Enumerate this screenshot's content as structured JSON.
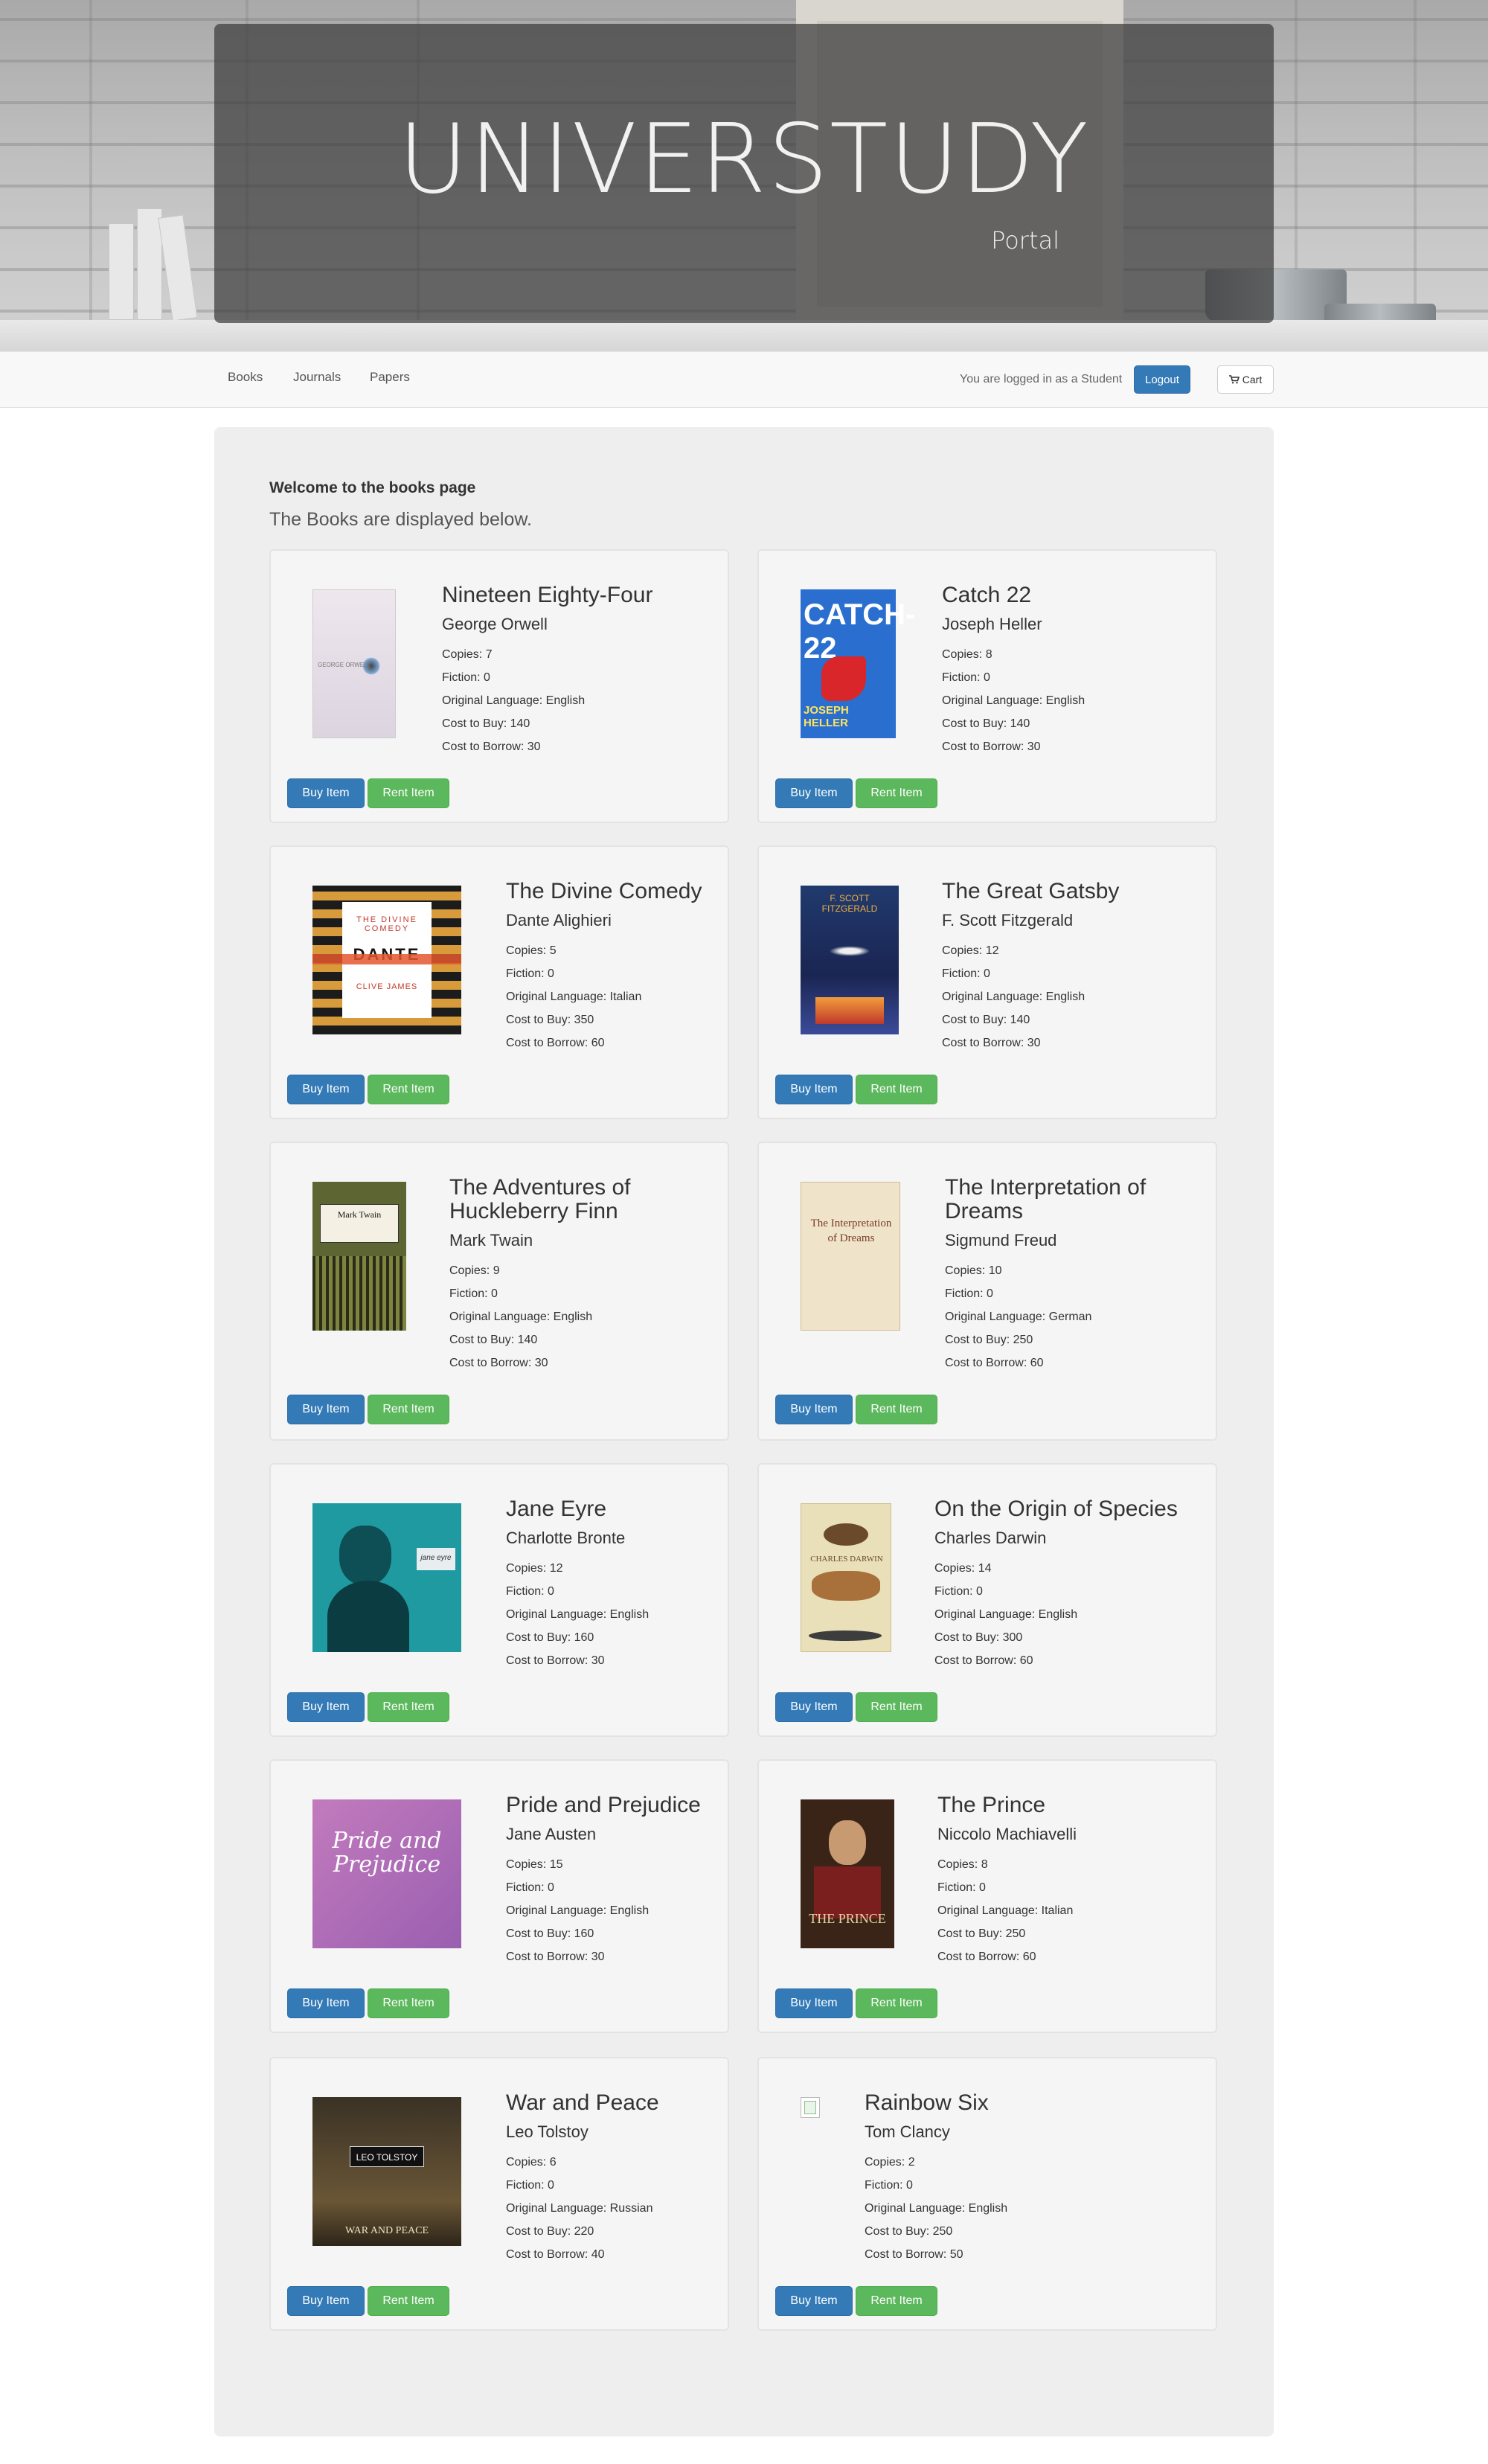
{
  "hero": {
    "title": "UNIVERSTUDY",
    "subtitle": "Portal"
  },
  "nav": {
    "links": [
      "Books",
      "Journals",
      "Papers"
    ],
    "login_text": "You are logged in as a Student",
    "logout_label": "Logout",
    "cart_label": "Cart"
  },
  "page": {
    "welcome": "Welcome to the books page",
    "subtitle": "The Books are displayed below."
  },
  "labels": {
    "buy": "Buy Item",
    "rent": "Rent Item"
  },
  "books": [
    {
      "title": "Nineteen Eighty-Four",
      "author": "George Orwell",
      "copies": "Copies: 7",
      "fiction": "Fiction: 0",
      "language": "Original Language: English",
      "buy": "Cost to Buy: 140",
      "borrow": "Cost to Borrow: 30",
      "cover_text": "GEORGE ORWELL"
    },
    {
      "title": "Catch 22",
      "author": "Joseph Heller",
      "copies": "Copies: 8",
      "fiction": "Fiction: 0",
      "language": "Original Language: English",
      "buy": "Cost to Buy: 140",
      "borrow": "Cost to Borrow: 30",
      "cover_text": "CATCH-22",
      "cover_text2": "JOSEPH HELLER"
    },
    {
      "title": "The Divine Comedy",
      "author": "Dante Alighieri",
      "copies": "Copies: 5",
      "fiction": "Fiction: 0",
      "language": "Original Language: Italian",
      "buy": "Cost to Buy: 350",
      "borrow": "Cost to Borrow: 60",
      "cover_text": "THE DIVINE COMEDY",
      "cover_text2": "DANTE",
      "cover_text3": "CLIVE JAMES"
    },
    {
      "title": "The Great Gatsby",
      "author": "F. Scott Fitzgerald",
      "copies": "Copies: 12",
      "fiction": "Fiction: 0",
      "language": "Original Language: English",
      "buy": "Cost to Buy: 140",
      "borrow": "Cost to Borrow: 30",
      "cover_text": "F. SCOTT FITZGERALD"
    },
    {
      "title": "The Adventures of Huckleberry Finn",
      "author": "Mark Twain",
      "copies": "Copies: 9",
      "fiction": "Fiction: 0",
      "language": "Original Language: English",
      "buy": "Cost to Buy: 140",
      "borrow": "Cost to Borrow: 30",
      "cover_text": "Mark Twain"
    },
    {
      "title": "The Interpretation of Dreams",
      "author": "Sigmund Freud",
      "copies": "Copies: 10",
      "fiction": "Fiction: 0",
      "language": "Original Language: German",
      "buy": "Cost to Buy: 250",
      "borrow": "Cost to Borrow: 60",
      "cover_text": "The Interpretation of Dreams"
    },
    {
      "title": "Jane Eyre",
      "author": "Charlotte Bronte",
      "copies": "Copies: 12",
      "fiction": "Fiction: 0",
      "language": "Original Language: English",
      "buy": "Cost to Buy: 160",
      "borrow": "Cost to Borrow: 30",
      "cover_text": "jane eyre"
    },
    {
      "title": "On the Origin of Species",
      "author": "Charles Darwin",
      "copies": "Copies: 14",
      "fiction": "Fiction: 0",
      "language": "Original Language: English",
      "buy": "Cost to Buy: 300",
      "borrow": "Cost to Borrow: 60",
      "cover_text": "CHARLES DARWIN"
    },
    {
      "title": "Pride and Prejudice",
      "author": "Jane Austen",
      "copies": "Copies: 15",
      "fiction": "Fiction: 0",
      "language": "Original Language: English",
      "buy": "Cost to Buy: 160",
      "borrow": "Cost to Borrow: 30",
      "cover_text": "Pride and Prejudice"
    },
    {
      "title": "The Prince",
      "author": "Niccolo Machiavelli",
      "copies": "Copies: 8",
      "fiction": "Fiction: 0",
      "language": "Original Language: Italian",
      "buy": "Cost to Buy: 250",
      "borrow": "Cost to Borrow: 60",
      "cover_text": "THE PRINCE"
    },
    {
      "title": "War and Peace",
      "author": "Leo Tolstoy",
      "copies": "Copies: 6",
      "fiction": "Fiction: 0",
      "language": "Original Language: Russian",
      "buy": "Cost to Buy: 220",
      "borrow": "Cost to Borrow: 40",
      "cover_text": "LEO TOLSTOY",
      "cover_text2": "WAR AND PEACE"
    },
    {
      "title": "Rainbow Six",
      "author": "Tom Clancy",
      "copies": "Copies: 2",
      "fiction": "Fiction: 0",
      "language": "Original Language: English",
      "buy": "Cost to Buy: 250",
      "borrow": "Cost to Borrow: 50"
    }
  ],
  "colors": {
    "primary": "#337ab7",
    "success": "#5cb85c",
    "card_bg": "#f5f5f5",
    "main_bg": "#eeeeee"
  }
}
